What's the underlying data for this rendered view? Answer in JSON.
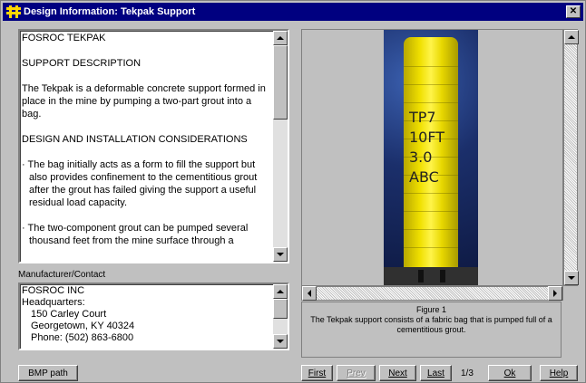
{
  "window": {
    "title": "Design Information: Tekpak Support",
    "close_glyph": "✕"
  },
  "description": {
    "company": "FOSROC TEKPAK",
    "support_heading": "SUPPORT DESCRIPTION",
    "support_text": "The Tekpak is a deformable concrete support formed in place in the mine by pumping a two-part grout into a bag.",
    "design_heading": "DESIGN AND INSTALLATION CONSIDERATIONS",
    "bullet1": "· The bag initially acts as a form to fill the support but also provides confinement to the cementitious grout after the grout has failed giving the support a useful residual load capacity.",
    "bullet2": "· The two-component grout can be pumped several thousand feet from the mine surface through a"
  },
  "manufacturer": {
    "label": "Manufacturer/Contact",
    "lines": [
      "FOSROC INC",
      "Headquarters:",
      "150 Carley Court",
      "Georgetown, KY 40324",
      "Phone: (502) 863-6800"
    ]
  },
  "photo": {
    "writing": [
      "TP7",
      "10FT",
      "3.0",
      "ABC"
    ]
  },
  "figure": {
    "number": "Figure 1",
    "caption": "The Tekpak support consists of a fabric bag that is pumped full of a cementitious grout."
  },
  "buttons": {
    "bmp_path": "BMP path",
    "first": "First",
    "prev": "Prev",
    "next": "Next",
    "last": "Last",
    "page": "1/3",
    "ok": "Ok",
    "help": "Help"
  }
}
